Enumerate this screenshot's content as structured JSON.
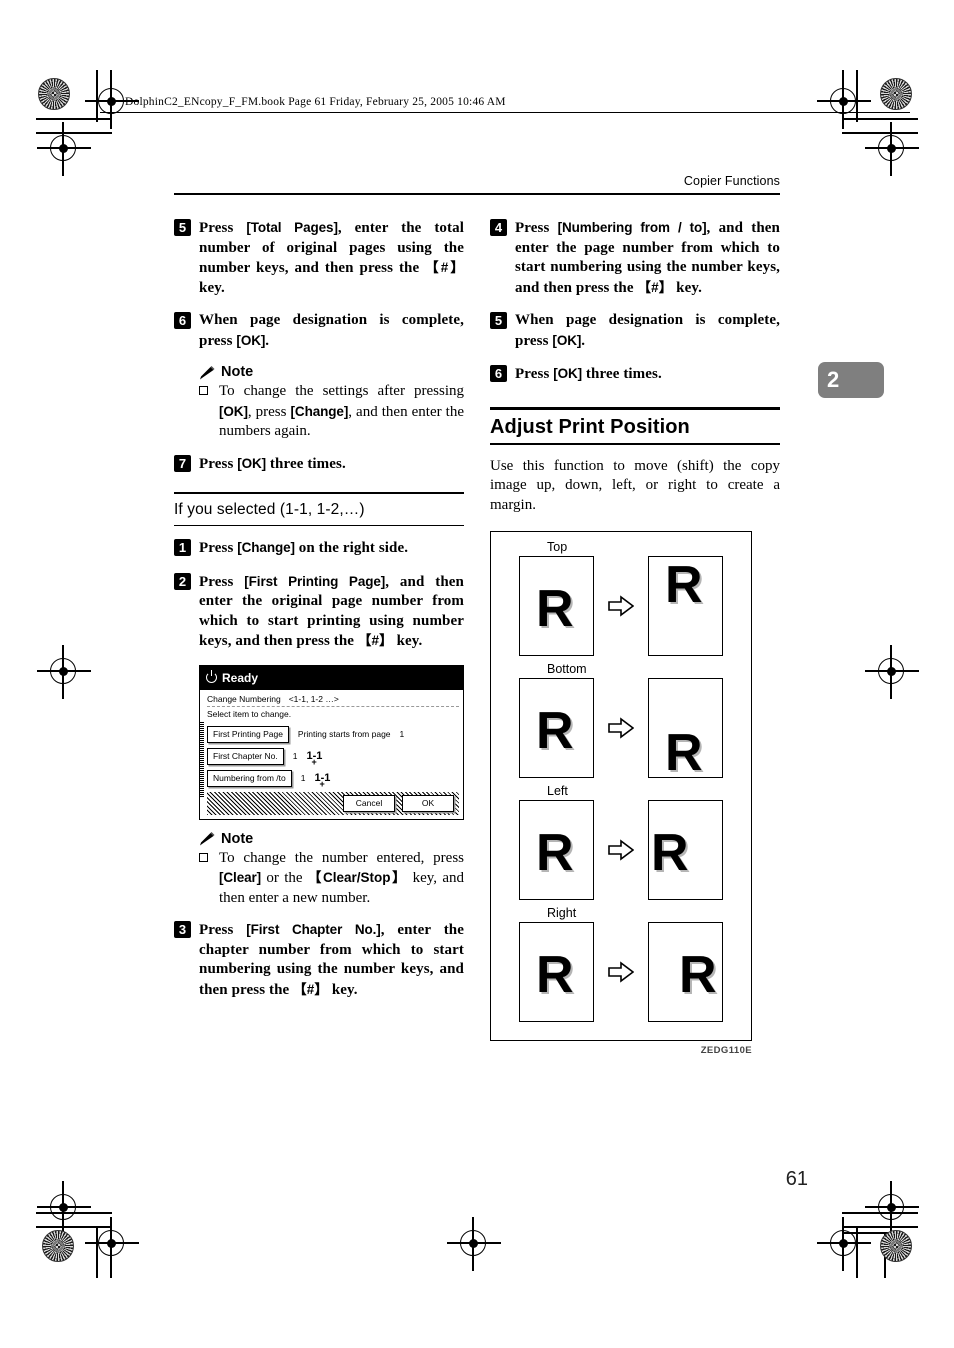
{
  "print_marks": {
    "book_header": "DolphinC2_ENcopy_F_FM.book  Page 61  Friday, February 25, 2005  10:46 AM"
  },
  "header": {
    "running_head": "Copier Functions",
    "chapter_tab": "2",
    "page_number": "61"
  },
  "left_column": {
    "steps": [
      {
        "num": "5",
        "segments": [
          {
            "t": "Press ",
            "style": "plain"
          },
          {
            "t": "[Total Pages]",
            "style": "uikey"
          },
          {
            "t": ", enter the total number of original pages using the number keys, and then press the ",
            "style": "plain"
          },
          {
            "t": "【#】",
            "style": "hardkey"
          },
          {
            "t": " key.",
            "style": "plain"
          }
        ]
      },
      {
        "num": "6",
        "segments": [
          {
            "t": "When page designation is complete, press ",
            "style": "plain"
          },
          {
            "t": "[OK]",
            "style": "uikey"
          },
          {
            "t": ".",
            "style": "plain"
          }
        ]
      }
    ],
    "note1": {
      "heading": "Note",
      "items": [
        [
          {
            "t": "To change the settings after pressing ",
            "style": "plain"
          },
          {
            "t": "[OK]",
            "style": "uikey"
          },
          {
            "t": ", press ",
            "style": "plain"
          },
          {
            "t": "[Change]",
            "style": "uikey"
          },
          {
            "t": ", and then enter the numbers again.",
            "style": "plain"
          }
        ]
      ]
    },
    "step7": {
      "num": "7",
      "segments": [
        {
          "t": "Press ",
          "style": "plain"
        },
        {
          "t": "[OK]",
          "style": "uikey"
        },
        {
          "t": " three times.",
          "style": "plain"
        }
      ]
    },
    "subsection_title": "If you selected (1-1, 1-2,…)",
    "steps_b": [
      {
        "num": "1",
        "segments": [
          {
            "t": "Press ",
            "style": "plain"
          },
          {
            "t": "[Change]",
            "style": "uikey"
          },
          {
            "t": " on the right side.",
            "style": "plain"
          }
        ]
      },
      {
        "num": "2",
        "segments": [
          {
            "t": "Press ",
            "style": "plain"
          },
          {
            "t": "[First Printing Page]",
            "style": "uikey"
          },
          {
            "t": ", and then enter the original page number from which to start printing using number keys, and then press the ",
            "style": "plain"
          },
          {
            "t": "【#】",
            "style": "hardkey"
          },
          {
            "t": " key.",
            "style": "plain"
          }
        ]
      }
    ],
    "lcd": {
      "status": "Ready",
      "title_line": "Change Numbering",
      "title_range": "<1-1, 1-2 …>",
      "subtitle": "Select item to change.",
      "rows": [
        {
          "button": "First Printing Page",
          "label": "Printing starts from page",
          "value": "1",
          "range": ""
        },
        {
          "button": "First Chapter No.",
          "label": "1",
          "value": "",
          "range": "1-1"
        },
        {
          "button": "Numbering from /to",
          "label": "1",
          "value": "",
          "range": "1-1"
        }
      ],
      "cancel": "Cancel",
      "ok": "OK"
    },
    "note2": {
      "heading": "Note",
      "items": [
        [
          {
            "t": "To change the number entered, press ",
            "style": "plain"
          },
          {
            "t": "[Clear]",
            "style": "uikey"
          },
          {
            "t": " or the ",
            "style": "plain"
          },
          {
            "t": "【Clear/Stop】",
            "style": "hardkey"
          },
          {
            "t": " key, and then enter a new number.",
            "style": "plain"
          }
        ]
      ]
    },
    "step3": {
      "num": "3",
      "segments": [
        {
          "t": "Press ",
          "style": "plain"
        },
        {
          "t": "[First Chapter No.]",
          "style": "uikey"
        },
        {
          "t": ", enter the chapter number from which to start numbering using the number keys, and then press the ",
          "style": "plain"
        },
        {
          "t": "【#】",
          "style": "hardkey"
        },
        {
          "t": " key.",
          "style": "plain"
        }
      ]
    }
  },
  "right_column": {
    "steps": [
      {
        "num": "4",
        "segments": [
          {
            "t": "Press ",
            "style": "plain"
          },
          {
            "t": "[Numbering from / to]",
            "style": "uikey"
          },
          {
            "t": ", and then enter the page number from which to start numbering using the number keys, and then press the ",
            "style": "plain"
          },
          {
            "t": "【#】",
            "style": "hardkey"
          },
          {
            "t": " key.",
            "style": "plain"
          }
        ]
      },
      {
        "num": "5",
        "segments": [
          {
            "t": "When page designation is complete, press ",
            "style": "plain"
          },
          {
            "t": "[OK]",
            "style": "uikey"
          },
          {
            "t": ".",
            "style": "plain"
          }
        ]
      },
      {
        "num": "6",
        "segments": [
          {
            "t": "Press ",
            "style": "plain"
          },
          {
            "t": "[OK]",
            "style": "uikey"
          },
          {
            "t": " three times.",
            "style": "plain"
          }
        ]
      }
    ],
    "heading": "Adjust Print Position",
    "intro": "Use this function to move (shift) the copy image up, down, left, or right to create a margin.",
    "figure": {
      "code": "ZEDG110E",
      "groups": [
        {
          "label": "Top",
          "before": "R",
          "before_pos": "center",
          "after": "R",
          "after_pos": "up"
        },
        {
          "label": "Bottom",
          "before": "R",
          "before_pos": "center",
          "after": "R",
          "after_pos": "down"
        },
        {
          "label": "Left",
          "before": "R",
          "before_pos": "center",
          "after": "R",
          "after_pos": "leftp"
        },
        {
          "label": "Right",
          "before": "R",
          "before_pos": "center",
          "after": "R",
          "after_pos": "rightp"
        }
      ]
    }
  }
}
